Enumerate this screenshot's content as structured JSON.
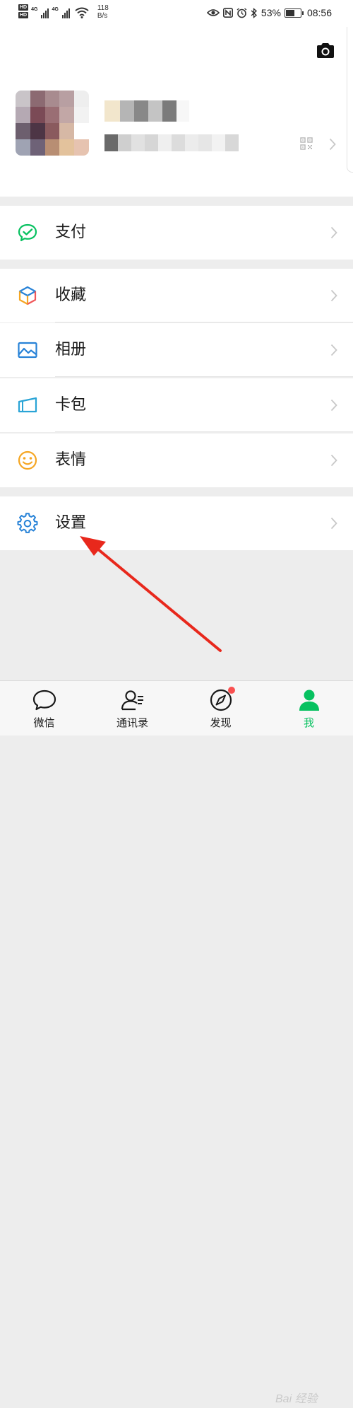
{
  "status_bar": {
    "hd_labels": [
      "HD",
      "HD"
    ],
    "network_labels": [
      "4G",
      "4G"
    ],
    "net_speed_value": "118",
    "net_speed_unit": "B/s",
    "battery_percent": "53%",
    "battery_level": 0.53,
    "time": "08:56",
    "icons": [
      "eye-icon",
      "nfc-icon",
      "alarm-icon",
      "bluetooth-icon",
      "battery-icon"
    ]
  },
  "profile": {
    "camera_icon": "camera-icon",
    "qr_icon": "qr-code-icon",
    "avatar_blur_colors": [
      "#c9c4c8",
      "#8c6a72",
      "#a88b8f",
      "#b89fa2",
      "#eeeeee",
      "#b5a9b3",
      "#7b4a56",
      "#9a6e74",
      "#c2a7a6",
      "#f2f2f2",
      "#6d5f6e",
      "#4d3545",
      "#8a5a5e",
      "#d6b8a5",
      "#ffffff",
      "#9fa3b3",
      "#6e6277",
      "#b88e73",
      "#e3c29c",
      "#e6c3b0"
    ],
    "nickname_blur_colors": [
      "#f2e6cc",
      "#b5b5b5",
      "#888888",
      "#c4c4c4",
      "#7b7b7b",
      "#f7f7f7"
    ],
    "wxid_blur_colors": [
      "#6a6a6a",
      "#cfcfcf",
      "#e1e1e1",
      "#d6d6d6",
      "#efefef",
      "#dcdcdc",
      "#ececec",
      "#e6e6e6",
      "#f2f2f2",
      "#d8d8d8"
    ]
  },
  "menu": {
    "pay": {
      "label": "支付",
      "icon": "pay-icon",
      "color": "#07c160"
    },
    "favorites": {
      "label": "收藏",
      "icon": "favorites-cube-icon"
    },
    "album": {
      "label": "相册",
      "icon": "album-icon",
      "color": "#2782d7"
    },
    "cards": {
      "label": "卡包",
      "icon": "card-wallet-icon",
      "color": "#2aa4d6"
    },
    "stickers": {
      "label": "表情",
      "icon": "smiley-icon",
      "color": "#f5a623"
    },
    "settings": {
      "label": "设置",
      "icon": "gear-icon",
      "color": "#2782d7"
    }
  },
  "tabbar": {
    "tabs": [
      {
        "label": "微信",
        "icon": "chat-bubble-icon"
      },
      {
        "label": "通讯录",
        "icon": "contacts-icon"
      },
      {
        "label": "发现",
        "icon": "compass-icon",
        "badge": "red-dot"
      },
      {
        "label": "我",
        "icon": "me-person-icon",
        "active": true
      }
    ],
    "active_color": "#07c160"
  },
  "annotation": {
    "arrow_color": "#e8281c"
  },
  "watermark": {
    "text": "Bai 经验"
  }
}
